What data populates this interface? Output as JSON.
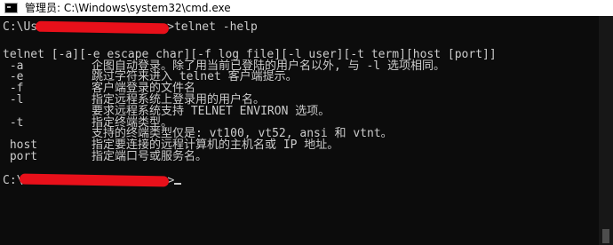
{
  "window": {
    "title": "管理员: C:\\Windows\\system32\\cmd.exe"
  },
  "console": {
    "command_prompt_prefix": "C:\\Us",
    "command_prompt_suffix": ">telnet -help",
    "usage": "telnet [-a][-e escape char][-f log file][-l user][-t term][host [port]]",
    "options": [
      {
        "flag": " -a",
        "text": "企图自动登录。除了用当前已登陆的用户名以外, 与 -l 选项相同。"
      },
      {
        "flag": " -e",
        "text": "跳过字符来进入 telnet 客户端提示。"
      },
      {
        "flag": " -f",
        "text": "客户端登录的文件名"
      },
      {
        "flag": " -l",
        "text": "指定远程系统上登录用的用户名。"
      },
      {
        "flag": "",
        "text": "要求远程系统支持 TELNET ENVIRON 选项。"
      },
      {
        "flag": " -t",
        "text": "指定终端类型。"
      },
      {
        "flag": "",
        "text": "支持的终端类型仅是: vt100, vt52, ansi 和 vtnt。"
      },
      {
        "flag": " host",
        "text": "指定要连接的远程计算机的主机名或 IP 地址。"
      },
      {
        "flag": " port",
        "text": "指定端口号或服务名。"
      }
    ],
    "final_prompt_prefix": "C:\\",
    "final_prompt_suffix": ">"
  },
  "colors": {
    "console_bg": "#0c0c0c",
    "console_fg": "#cccccc",
    "redaction": "#e8101a"
  }
}
